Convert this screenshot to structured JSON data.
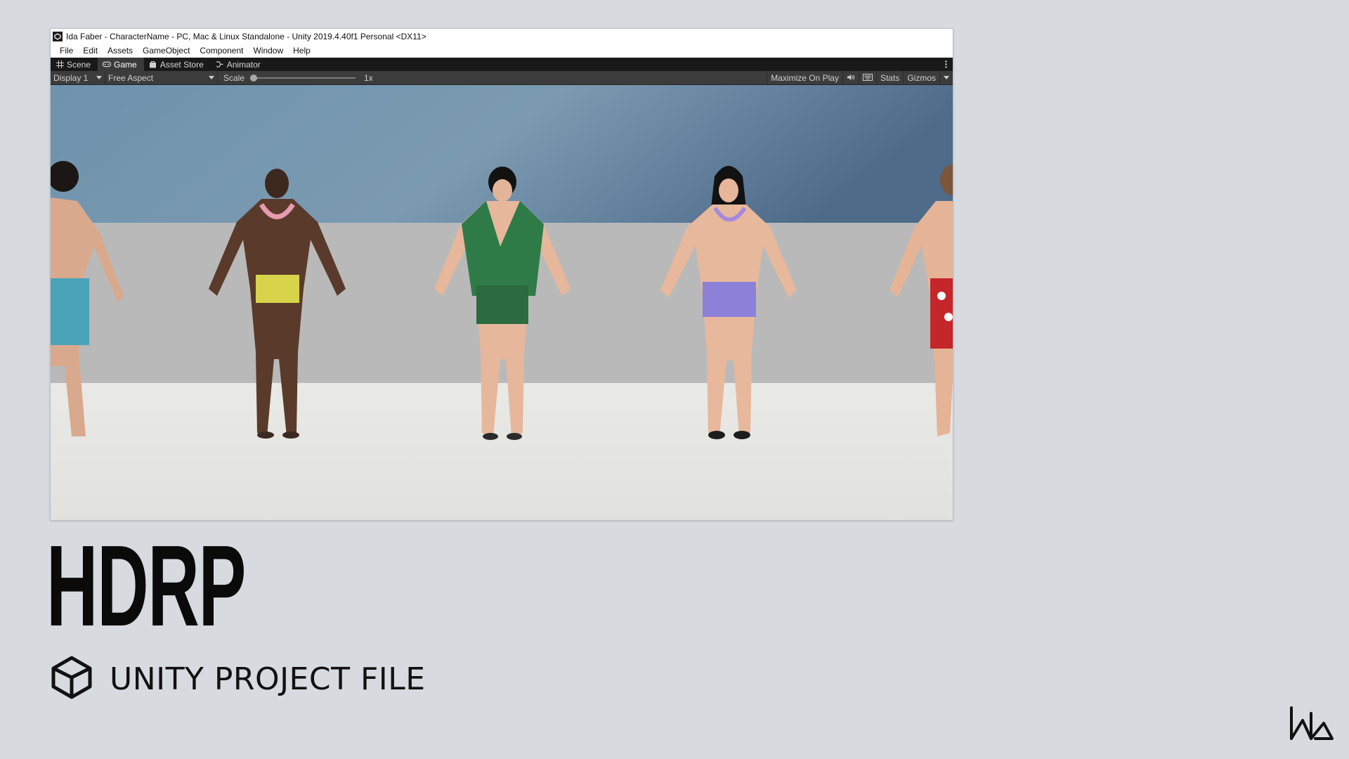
{
  "window": {
    "title": "Ida Faber - CharacterName - PC, Mac & Linux Standalone - Unity 2019.4.40f1 Personal <DX11>"
  },
  "menubar": {
    "items": [
      "File",
      "Edit",
      "Assets",
      "GameObject",
      "Component",
      "Window",
      "Help"
    ]
  },
  "tabs": [
    {
      "label": "Scene",
      "icon": "grid-icon",
      "active": false
    },
    {
      "label": "Game",
      "icon": "gamepad-icon",
      "active": true
    },
    {
      "label": "Asset Store",
      "icon": "bag-icon",
      "active": false
    },
    {
      "label": "Animator",
      "icon": "animator-icon",
      "active": false
    }
  ],
  "toolbar": {
    "display": "Display 1",
    "aspect": "Free Aspect",
    "scale_label": "Scale",
    "scale_value": "1x",
    "maximize": "Maximize On Play",
    "stats": "Stats",
    "gizmos": "Gizmos"
  },
  "colors": {
    "accent_dark": "#191919",
    "toolbar": "#3c3c3c",
    "background": "#d7dbe0"
  },
  "overlay": {
    "headline": "HDRP",
    "subtitle": "UNITY PROJECT FILE"
  }
}
